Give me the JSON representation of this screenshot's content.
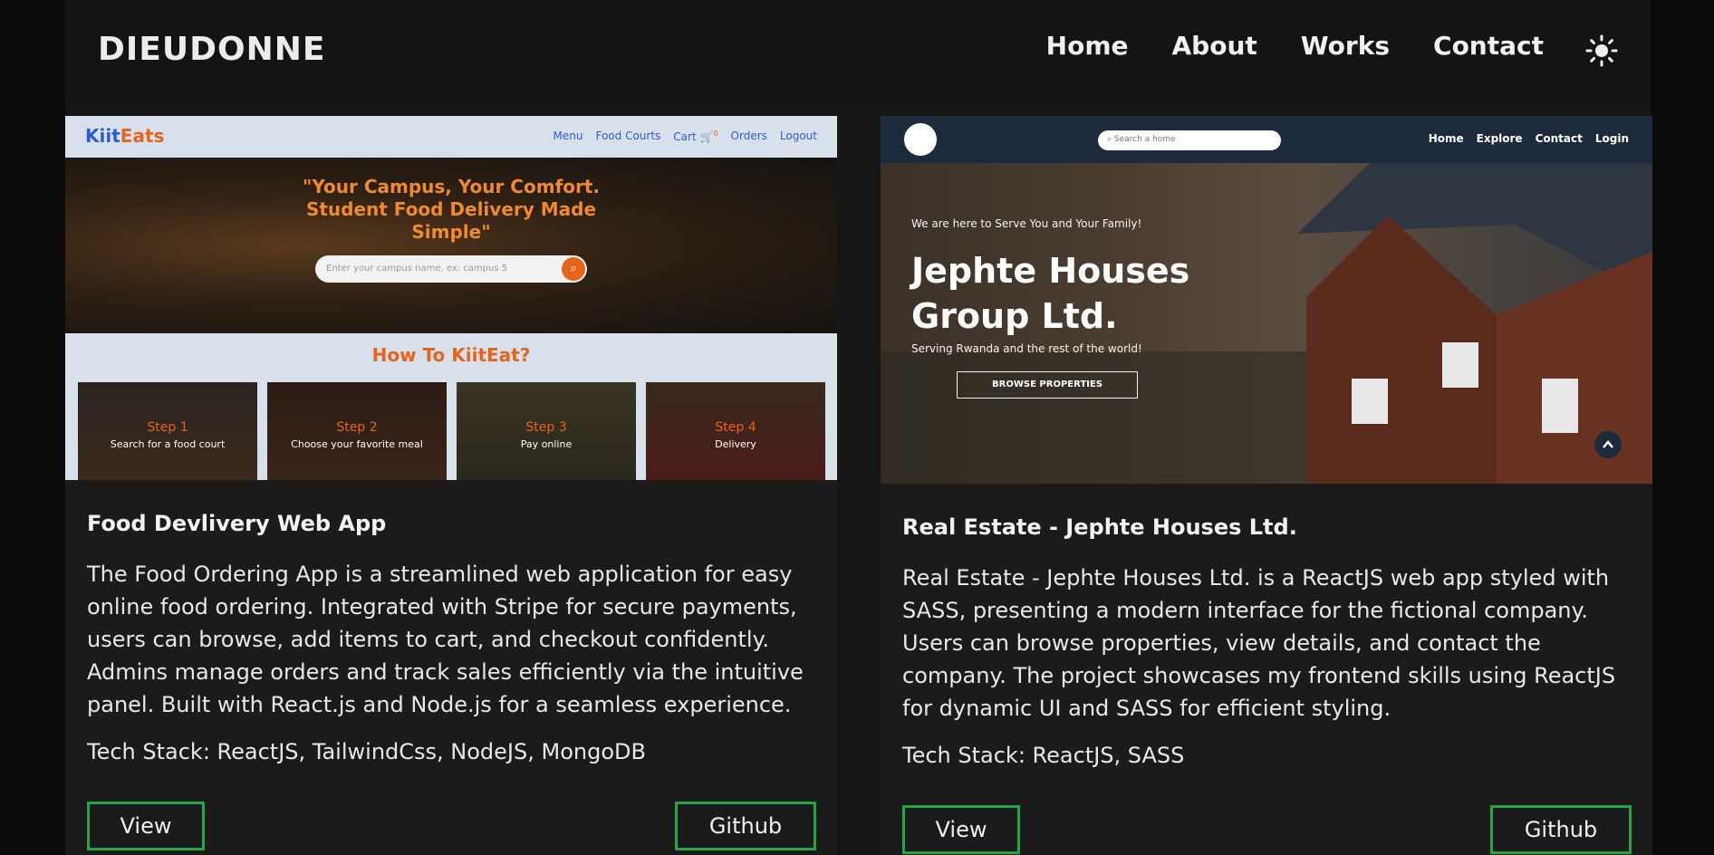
{
  "brand": "DIEUDONNE",
  "nav": {
    "links": [
      "Home",
      "About",
      "Works",
      "Contact"
    ],
    "theme_icon": "sun-icon"
  },
  "colors": {
    "background": "#161616",
    "button_border": "#22a547",
    "kiiteats_blue": "#2c5bd6",
    "kiiteats_orange": "#e8641a",
    "jephte_navy": "#1d2a3b"
  },
  "projects": [
    {
      "title": "Food Devlivery Web App",
      "description": "The Food Ordering App is a streamlined web application for easy online food ordering. Integrated with Stripe for secure payments, users can browse, add items to cart, and checkout confidently. Admins manage orders and track sales efficiently via the intuitive panel. Built with React.js and Node.js for a seamless experience.",
      "tech_stack": "Tech Stack: ReactJS, TailwindCss, NodeJS, MongoDB",
      "view_label": "View",
      "github_label": "Github",
      "preview": {
        "logo_a": "Kiit",
        "logo_b": "Eats",
        "menu": [
          "Menu",
          "Food Courts",
          "Cart",
          "Orders",
          "Logout"
        ],
        "cart_count": "0",
        "hero_text": "\"Your Campus, Your Comfort. Student Food Delivery Made Simple\"",
        "search_placeholder": "Enter your campus name, ex: campus 5",
        "how_title": "How To KiitEat?",
        "steps": [
          {
            "num": "Step 1",
            "label": "Search for a food court"
          },
          {
            "num": "Step 2",
            "label": "Choose your favorite meal"
          },
          {
            "num": "Step 3",
            "label": "Pay online"
          },
          {
            "num": "Step 4",
            "label": "Delivery"
          }
        ]
      }
    },
    {
      "title": "Real Estate - Jephte Houses Ltd.",
      "description": "Real Estate - Jephte Houses Ltd. is a ReactJS web app styled with SASS, presenting a modern interface for the fictional company. Users can browse properties, view details, and contact the company. The project showcases my frontend skills using ReactJS for dynamic UI and SASS for efficient styling.",
      "tech_stack": "Tech Stack: ReactJS, SASS",
      "view_label": "View",
      "github_label": "Github",
      "preview": {
        "search_placeholder": "Search a home",
        "menu": [
          "Home",
          "Explore",
          "Contact",
          "Login"
        ],
        "tagline": "We are here to Serve You and Your Family!",
        "title": "Jephte Houses Group Ltd.",
        "subtitle": "Serving Rwanda and the rest of the world!",
        "browse_label": "BROWSE PROPERTIES"
      }
    }
  ]
}
